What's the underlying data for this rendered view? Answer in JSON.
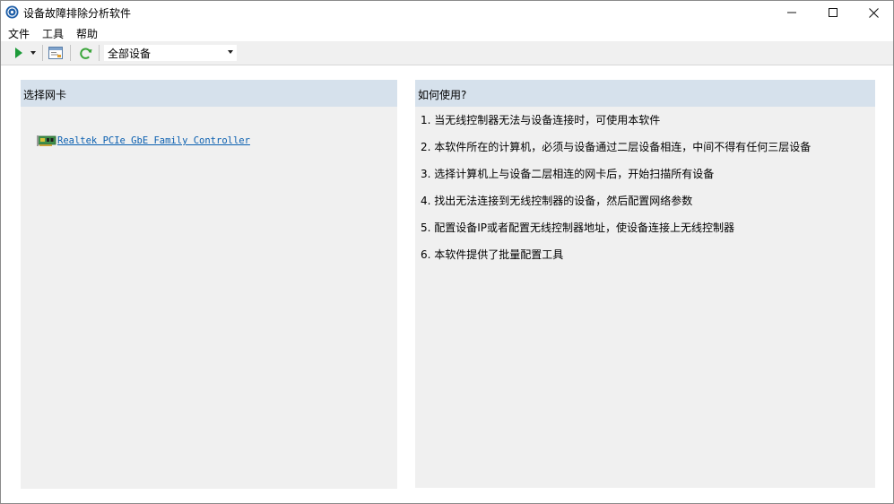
{
  "window": {
    "title": "设备故障排除分析软件"
  },
  "menu": [
    "文件",
    "工具",
    "帮助"
  ],
  "toolbar": {
    "device_filter": "全部设备"
  },
  "left_panel": {
    "header": "选择网卡",
    "adapters": [
      "Realtek PCIe GbE Family Controller"
    ]
  },
  "right_panel": {
    "header": "如何使用?",
    "steps": [
      "1. 当无线控制器无法与设备连接时，可使用本软件",
      "2. 本软件所在的计算机，必须与设备通过二层设备相连，中间不得有任何三层设备",
      "3. 选择计算机上与设备二层相连的网卡后，开始扫描所有设备",
      "4. 找出无法连接到无线控制器的设备，然后配置网络参数",
      "5. 配置设备IP或者配置无线控制器地址，使设备连接上无线控制器",
      "6. 本软件提供了批量配置工具"
    ]
  },
  "colors": {
    "panel_bg": "#f0f0f0",
    "header_bg": "#d6e1ec",
    "link": "#0a5fb0",
    "run_green": "#1d9b3a",
    "refresh_green": "#3aa53a"
  }
}
